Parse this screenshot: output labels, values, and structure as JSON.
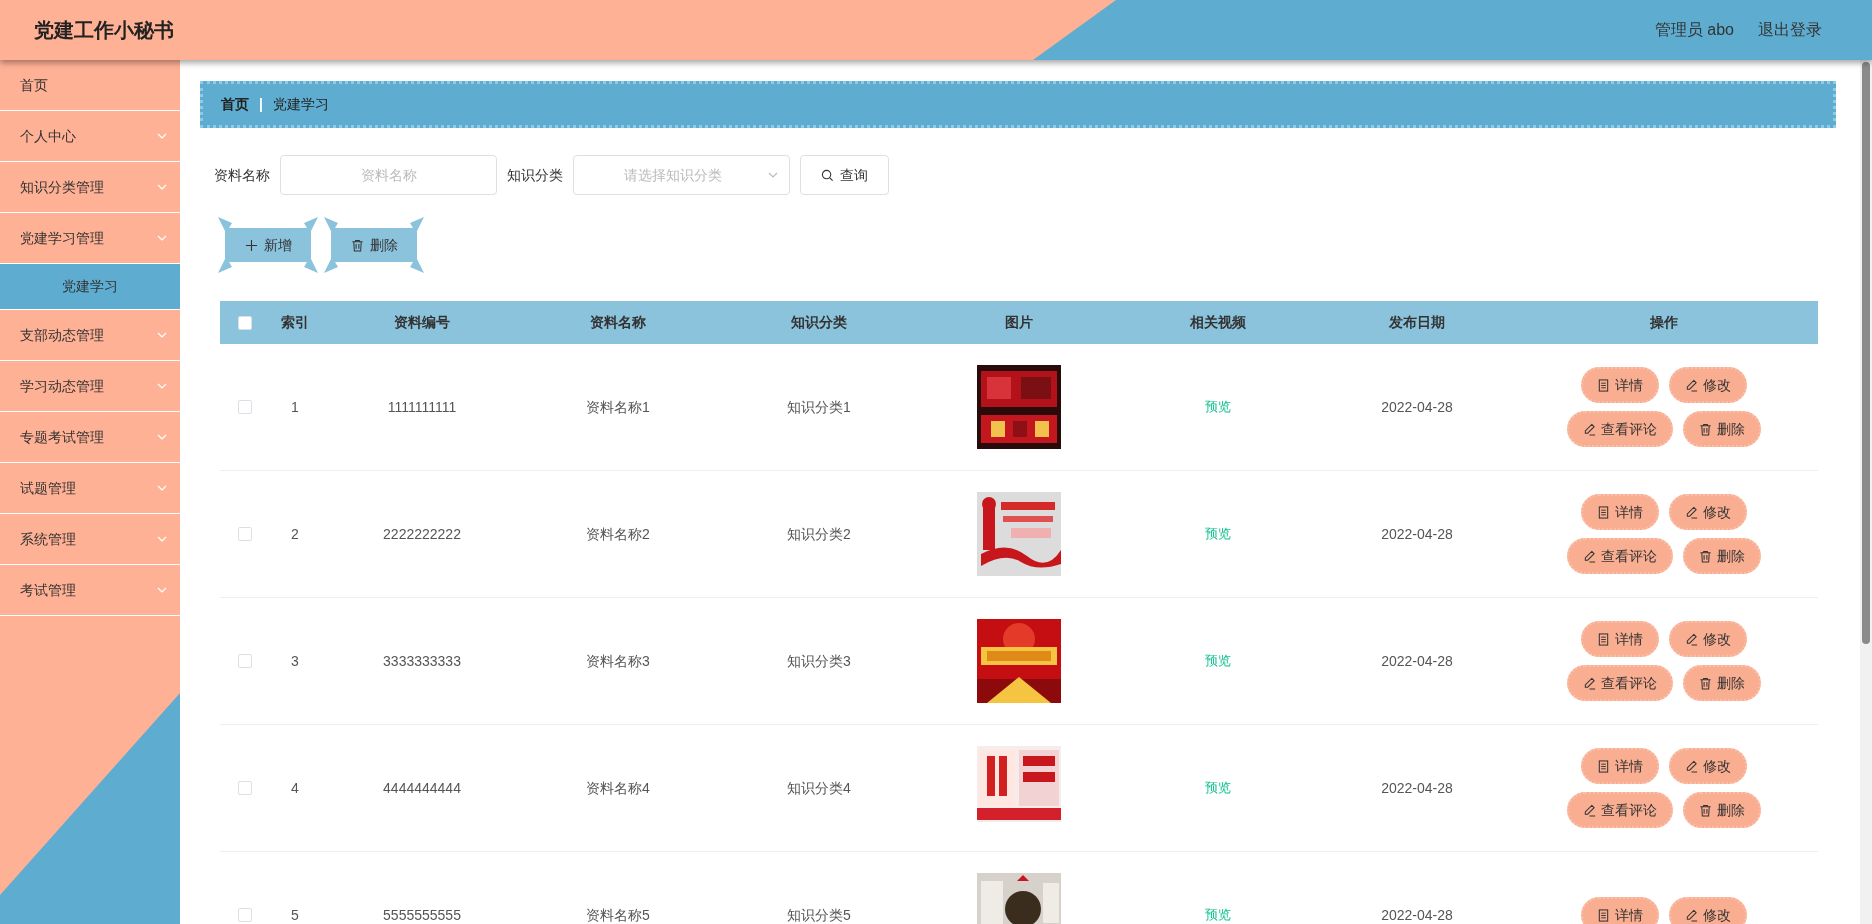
{
  "app_title": "党建工作小秘书",
  "header_actions": [
    {
      "label": "管理员 abo"
    },
    {
      "label": "退出登录"
    }
  ],
  "sidebar": {
    "items": [
      {
        "label": "首页",
        "kind": "link",
        "selected": false
      },
      {
        "label": "个人中心",
        "kind": "group",
        "selected": false
      },
      {
        "label": "知识分类管理",
        "kind": "group",
        "selected": false
      },
      {
        "label": "党建学习管理",
        "kind": "group",
        "selected": false,
        "children": [
          {
            "label": "党建学习",
            "selected": true
          }
        ]
      },
      {
        "label": "支部动态管理",
        "kind": "group",
        "selected": false
      },
      {
        "label": "学习动态管理",
        "kind": "group",
        "selected": false
      },
      {
        "label": "专题考试管理",
        "kind": "group",
        "selected": false
      },
      {
        "label": "试题管理",
        "kind": "group",
        "selected": false
      },
      {
        "label": "系统管理",
        "kind": "group",
        "selected": false
      },
      {
        "label": "考试管理",
        "kind": "group",
        "selected": false
      }
    ]
  },
  "breadcrumb": [
    {
      "label": "首页"
    },
    {
      "label": "党建学习"
    }
  ],
  "breadcrumb_separator": "|",
  "search": {
    "fields": [
      {
        "label": "资料名称",
        "kind": "text",
        "placeholder": "资料名称"
      },
      {
        "label": "知识分类",
        "kind": "select",
        "placeholder": "请选择知识分类"
      }
    ],
    "button": "查询"
  },
  "toolbar": [
    {
      "label": "新增",
      "kind": "add"
    },
    {
      "label": "删除",
      "kind": "delete"
    }
  ],
  "table": {
    "header_checked": false,
    "columns": [
      "索引",
      "资料编号",
      "资料名称",
      "知识分类",
      "图片",
      "相关视频",
      "发布日期",
      "操作"
    ],
    "rows": [
      {
        "checked": false,
        "index": "1",
        "code": "1111111111",
        "name": "资料名称1",
        "category": "知识分类1",
        "video": "预览",
        "date": "2022-04-28",
        "actions": [
          {
            "label": "详情",
            "kind": "detail"
          },
          {
            "label": "修改",
            "kind": "edit"
          },
          {
            "label": "查看评论",
            "kind": "edit"
          },
          {
            "label": "删除",
            "kind": "delete"
          }
        ]
      },
      {
        "checked": false,
        "index": "2",
        "code": "2222222222",
        "name": "资料名称2",
        "category": "知识分类2",
        "video": "预览",
        "date": "2022-04-28",
        "actions": [
          {
            "label": "详情",
            "kind": "detail"
          },
          {
            "label": "修改",
            "kind": "edit"
          },
          {
            "label": "查看评论",
            "kind": "edit"
          },
          {
            "label": "删除",
            "kind": "delete"
          }
        ]
      },
      {
        "checked": false,
        "index": "3",
        "code": "3333333333",
        "name": "资料名称3",
        "category": "知识分类3",
        "video": "预览",
        "date": "2022-04-28",
        "actions": [
          {
            "label": "详情",
            "kind": "detail"
          },
          {
            "label": "修改",
            "kind": "edit"
          },
          {
            "label": "查看评论",
            "kind": "edit"
          },
          {
            "label": "删除",
            "kind": "delete"
          }
        ]
      },
      {
        "checked": false,
        "index": "4",
        "code": "4444444444",
        "name": "资料名称4",
        "category": "知识分类4",
        "video": "预览",
        "date": "2022-04-28",
        "actions": [
          {
            "label": "详情",
            "kind": "detail"
          },
          {
            "label": "修改",
            "kind": "edit"
          },
          {
            "label": "查看评论",
            "kind": "edit"
          },
          {
            "label": "删除",
            "kind": "delete"
          }
        ]
      },
      {
        "checked": false,
        "index": "5",
        "code": "5555555555",
        "name": "资料名称5",
        "category": "知识分类5",
        "video": "预览",
        "date": "2022-04-28",
        "actions": [
          {
            "label": "详情",
            "kind": "detail"
          },
          {
            "label": "修改",
            "kind": "edit"
          }
        ]
      }
    ]
  }
}
